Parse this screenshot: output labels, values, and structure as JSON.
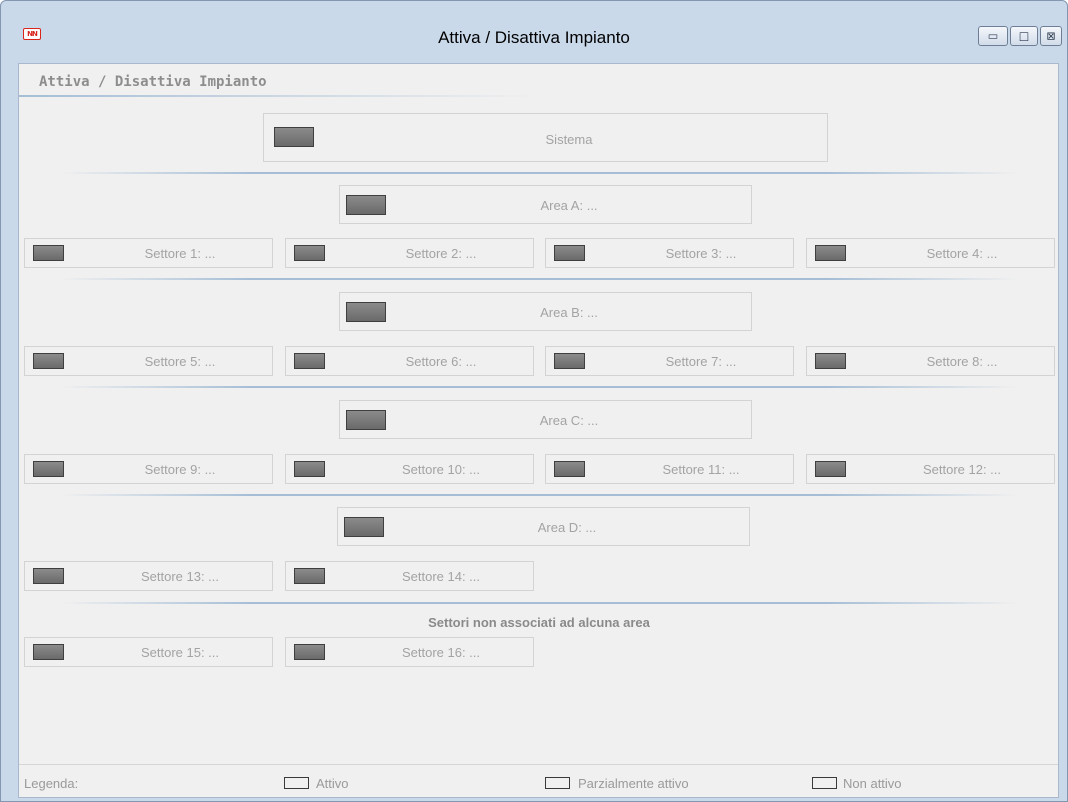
{
  "window": {
    "title": "Attiva / Disattiva Impianto",
    "app_icon_text": "NN",
    "minimize_glyph": "▭",
    "maximize_glyph": "□",
    "close_glyph": "⊠"
  },
  "group_header": "Attiva / Disattiva Impianto",
  "sistema": {
    "label": "Sistema"
  },
  "areas": [
    {
      "label": "Area A: ...",
      "settori": [
        "Settore 1: ...",
        "Settore 2: ...",
        "Settore 3: ...",
        "Settore 4: ..."
      ]
    },
    {
      "label": "Area B: ...",
      "settori": [
        "Settore 5: ...",
        "Settore 6: ...",
        "Settore 7: ...",
        "Settore 8: ..."
      ]
    },
    {
      "label": "Area C: ...",
      "settori": [
        "Settore 9: ...",
        "Settore 10: ...",
        "Settore 11: ...",
        "Settore 12: ..."
      ]
    },
    {
      "label": "Area D: ...",
      "settori": [
        "Settore 13: ...",
        "Settore 14: ..."
      ]
    }
  ],
  "unassociated": {
    "title": "Settori non associati ad alcuna area",
    "settori": [
      "Settore 15: ...",
      "Settore 16: ..."
    ]
  },
  "legend": {
    "label": "Legenda:",
    "attivo": "Attivo",
    "parziale": "Parzialmente attivo",
    "non_attivo": "Non attivo"
  },
  "colors": {
    "led_fill": "#7a7a7a",
    "disabled_text": "#a3a3a3",
    "separator": "#a5bed6"
  }
}
